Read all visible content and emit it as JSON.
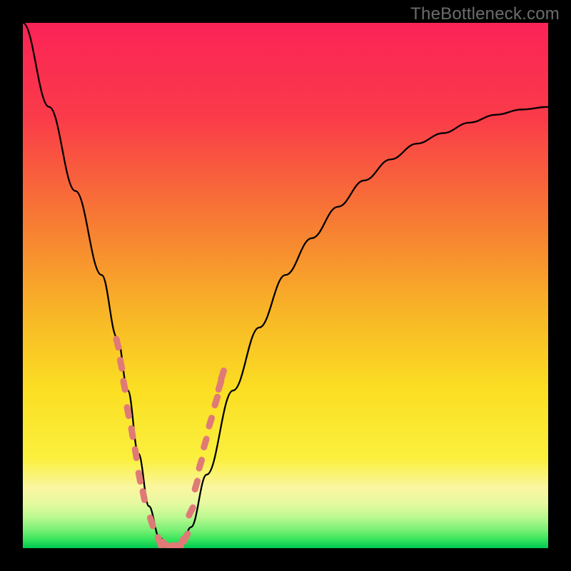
{
  "watermark": "TheBottleneck.com",
  "chart_data": {
    "type": "line",
    "title": "",
    "xlabel": "",
    "ylabel": "",
    "xlim": [
      0,
      100
    ],
    "ylim": [
      0,
      100
    ],
    "x": [
      0,
      5,
      10,
      15,
      18,
      20,
      22,
      24,
      26,
      28,
      30,
      32,
      35,
      40,
      45,
      50,
      55,
      60,
      65,
      70,
      75,
      80,
      85,
      90,
      95,
      100
    ],
    "values": [
      100,
      84,
      68,
      52,
      40,
      30,
      18,
      8,
      2,
      0,
      0,
      4,
      14,
      30,
      42,
      52,
      59,
      65,
      70,
      74,
      77,
      79,
      81,
      82.5,
      83.5,
      84
    ],
    "band_colors": {
      "top_red": "#fb2357",
      "mid_orange": "#f59a2b",
      "yellow": "#fbe823",
      "light_yellow": "#faf6a1",
      "pale_green": "#bcf991",
      "green": "#39e55d",
      "bottom_green": "#00c853"
    },
    "curve_color": "#000000",
    "marker_color": "#e07a77",
    "markers_left": [
      {
        "x": 18.0,
        "y": 39
      },
      {
        "x": 18.7,
        "y": 35
      },
      {
        "x": 19.3,
        "y": 31
      },
      {
        "x": 20.0,
        "y": 26
      },
      {
        "x": 20.8,
        "y": 22
      },
      {
        "x": 21.5,
        "y": 18
      },
      {
        "x": 22.2,
        "y": 13.5
      },
      {
        "x": 23.0,
        "y": 10
      },
      {
        "x": 24.5,
        "y": 5
      }
    ],
    "markers_right": [
      {
        "x": 32.0,
        "y": 7
      },
      {
        "x": 33.0,
        "y": 12
      },
      {
        "x": 33.8,
        "y": 16
      },
      {
        "x": 34.7,
        "y": 20
      },
      {
        "x": 35.7,
        "y": 24
      },
      {
        "x": 36.8,
        "y": 28
      },
      {
        "x": 37.5,
        "y": 31
      },
      {
        "x": 38.0,
        "y": 33
      }
    ],
    "markers_bottom": [
      {
        "x": 26.0,
        "y": 1.3
      },
      {
        "x": 27.2,
        "y": 0.6
      },
      {
        "x": 28.3,
        "y": 0.4
      },
      {
        "x": 29.3,
        "y": 0.5
      },
      {
        "x": 30.2,
        "y": 1.0
      },
      {
        "x": 31.0,
        "y": 2.0
      }
    ]
  }
}
